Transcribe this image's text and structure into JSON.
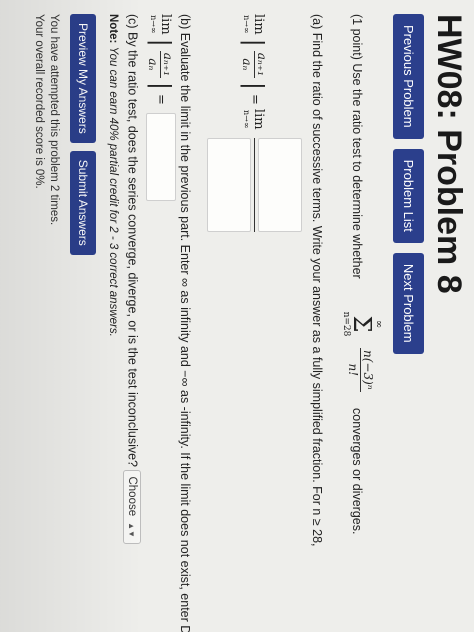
{
  "page": {
    "title": "HW08: Problem 8"
  },
  "nav": {
    "previous": "Previous Problem",
    "list": "Problem List",
    "next": "Next Problem"
  },
  "problem": {
    "intro": "(1 point) Use the ratio test to determine whether",
    "sum_upper": "∞",
    "sum_lower": "n=28",
    "series_num": "n(−3)ⁿ",
    "series_den": "n!",
    "intro_end": "converges or diverges.",
    "part_a": "(a) Find the ratio of successive terms. Write your answer as a fully simplified fraction. For n ≥ 28,",
    "lim_word": "lim",
    "lim_sub": "n→∞",
    "ratio_num": "aₙ₊₁",
    "ratio_den": "aₙ",
    "equals": "=",
    "part_b": "(b) Evaluate the limit in the previous part. Enter ∞ as infinity and −∞ as -infinity. If the limit does not exist, enter DNE.",
    "part_c": "(c) By the ratio test, does the series converge, diverge, or is the test inconclusive?",
    "select_value": "Choose"
  },
  "note": {
    "label": "Note:",
    "text": "You can earn 40% partial credit for 2 - 3 correct answers."
  },
  "actions": {
    "preview": "Preview My Answers",
    "submit": "Submit Answers"
  },
  "status": {
    "attempts": "You have attempted this problem 2 times.",
    "score": "Your overall recorded score is 0%."
  },
  "colors": {
    "button_blue": "#2b3f8c",
    "page_bg": "#eeeeeb"
  }
}
